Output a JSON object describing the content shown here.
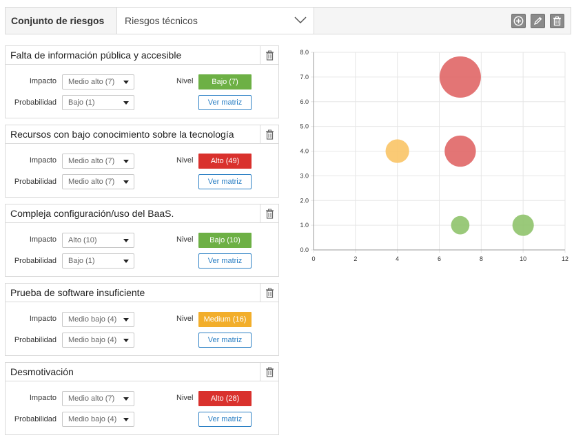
{
  "header": {
    "set_label": "Conjunto de riesgos",
    "set_selected": "Riesgos técnicos",
    "actions": [
      {
        "name": "add",
        "icon": "plus-circle-icon"
      },
      {
        "name": "edit",
        "icon": "pencil-icon"
      },
      {
        "name": "delete",
        "icon": "trash-icon"
      }
    ]
  },
  "labels": {
    "impacto": "Impacto",
    "probabilidad": "Probabilidad",
    "nivel": "Nivel",
    "ver_matriz": "Ver matriz"
  },
  "risks": [
    {
      "title": "Falta de información pública y accesible",
      "impacto": "Medio alto (7)",
      "probabilidad": "Bajo (1)",
      "nivel": "Bajo (7)",
      "nivel_color": "#6db045"
    },
    {
      "title": "Recursos con bajo conocimiento sobre la tecnología",
      "impacto": "Medio alto (7)",
      "probabilidad": "Medio alto (7)",
      "nivel": "Alto (49)",
      "nivel_color": "#d9312d"
    },
    {
      "title": "Compleja configuración/uso del BaaS.",
      "impacto": "Alto (10)",
      "probabilidad": "Bajo (1)",
      "nivel": "Bajo (10)",
      "nivel_color": "#6db045"
    },
    {
      "title": "Prueba de software insuficiente",
      "impacto": "Medio bajo (4)",
      "probabilidad": "Medio bajo (4)",
      "nivel": "Medium (16)",
      "nivel_color": "#f2ae2b"
    },
    {
      "title": "Desmotivación",
      "impacto": "Medio alto (7)",
      "probabilidad": "Medio bajo (4)",
      "nivel": "Alto (28)",
      "nivel_color": "#d9312d"
    }
  ],
  "chart_data": {
    "type": "scatter",
    "subtype": "bubble",
    "xlim": [
      0,
      12
    ],
    "ylim": [
      0,
      8
    ],
    "x_ticks": [
      "0",
      "2",
      "4",
      "6",
      "8",
      "10",
      "12"
    ],
    "y_ticks": [
      "0.0",
      "1.0",
      "2.0",
      "3.0",
      "4.0",
      "5.0",
      "6.0",
      "7.0",
      "8.0"
    ],
    "grid": true,
    "points": [
      {
        "x": 7,
        "y": 7,
        "size": 49,
        "color": "#e06666"
      },
      {
        "x": 4,
        "y": 4,
        "size": 16,
        "color": "#f9c466"
      },
      {
        "x": 7,
        "y": 4,
        "size": 28,
        "color": "#e06666"
      },
      {
        "x": 7,
        "y": 1,
        "size": 7,
        "color": "#8fc36b"
      },
      {
        "x": 10,
        "y": 1,
        "size": 10,
        "color": "#8fc36b"
      }
    ]
  }
}
